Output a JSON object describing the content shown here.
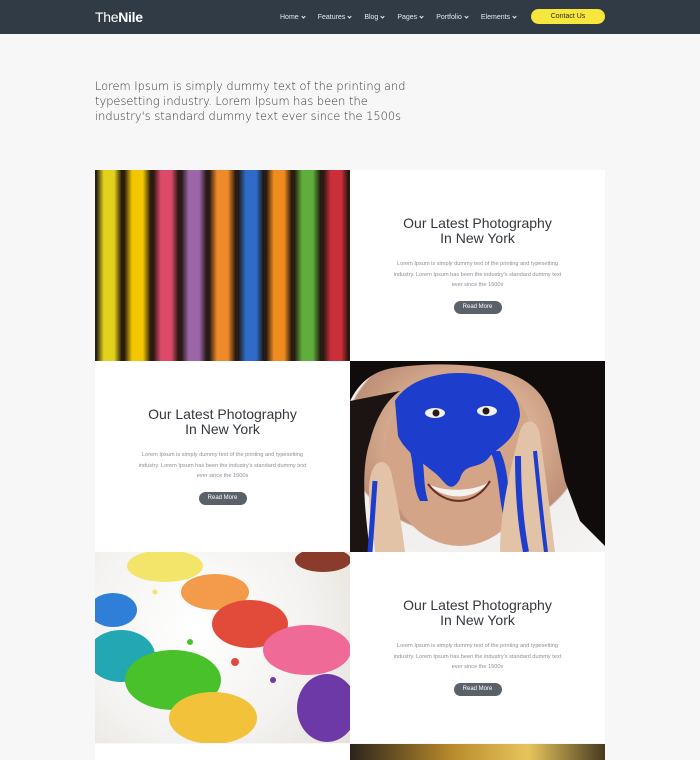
{
  "nav": {
    "logo_light": "The",
    "logo_bold": "Nile",
    "items": [
      {
        "label": "Home"
      },
      {
        "label": "Features"
      },
      {
        "label": "Blog"
      },
      {
        "label": "Pages"
      },
      {
        "label": "Portfolio"
      },
      {
        "label": "Elements"
      }
    ],
    "contact_label": "Contact Us",
    "colors": {
      "bar": "#313b46",
      "contact_button": "#f7e63b"
    }
  },
  "intro": {
    "text": "Lorem Ipsum is simply dummy text of the printing and typesetting industry. Lorem Ipsum has been the industry's standard dummy text ever since the 1500s"
  },
  "cards": [
    {
      "title_line1": "Our Latest Photography",
      "title_line2": "In New York",
      "desc": "Lorem Ipsum is simply dummy text of the printing and typesetting industry. Lorem Ipsum has been the industry's standard dummy text ever since the 1500s",
      "button": "Read More"
    },
    {
      "title_line1": "Our Latest Photography",
      "title_line2": "In New York",
      "desc": "Lorem Ipsum is simply dummy text of the printing and typesetting industry. Lorem Ipsum has been the industry's standard dummy text ever since the 1500s",
      "button": "Read More"
    },
    {
      "title_line1": "Our Latest Photography",
      "title_line2": "In New York",
      "desc": "Lorem Ipsum is simply dummy text of the printing and typesetting industry. Lorem Ipsum has been the industry's standard dummy text ever since the 1500s",
      "button": "Read More"
    }
  ],
  "images": {
    "chalk_colors": [
      "#e3d21c",
      "#f2c600",
      "#dc4a6a",
      "#9c67a8",
      "#ee8a2a",
      "#2e6cc8",
      "#f08b1f",
      "#5fae3c",
      "#cc2f3a"
    ],
    "button_color": "#5a6168"
  }
}
